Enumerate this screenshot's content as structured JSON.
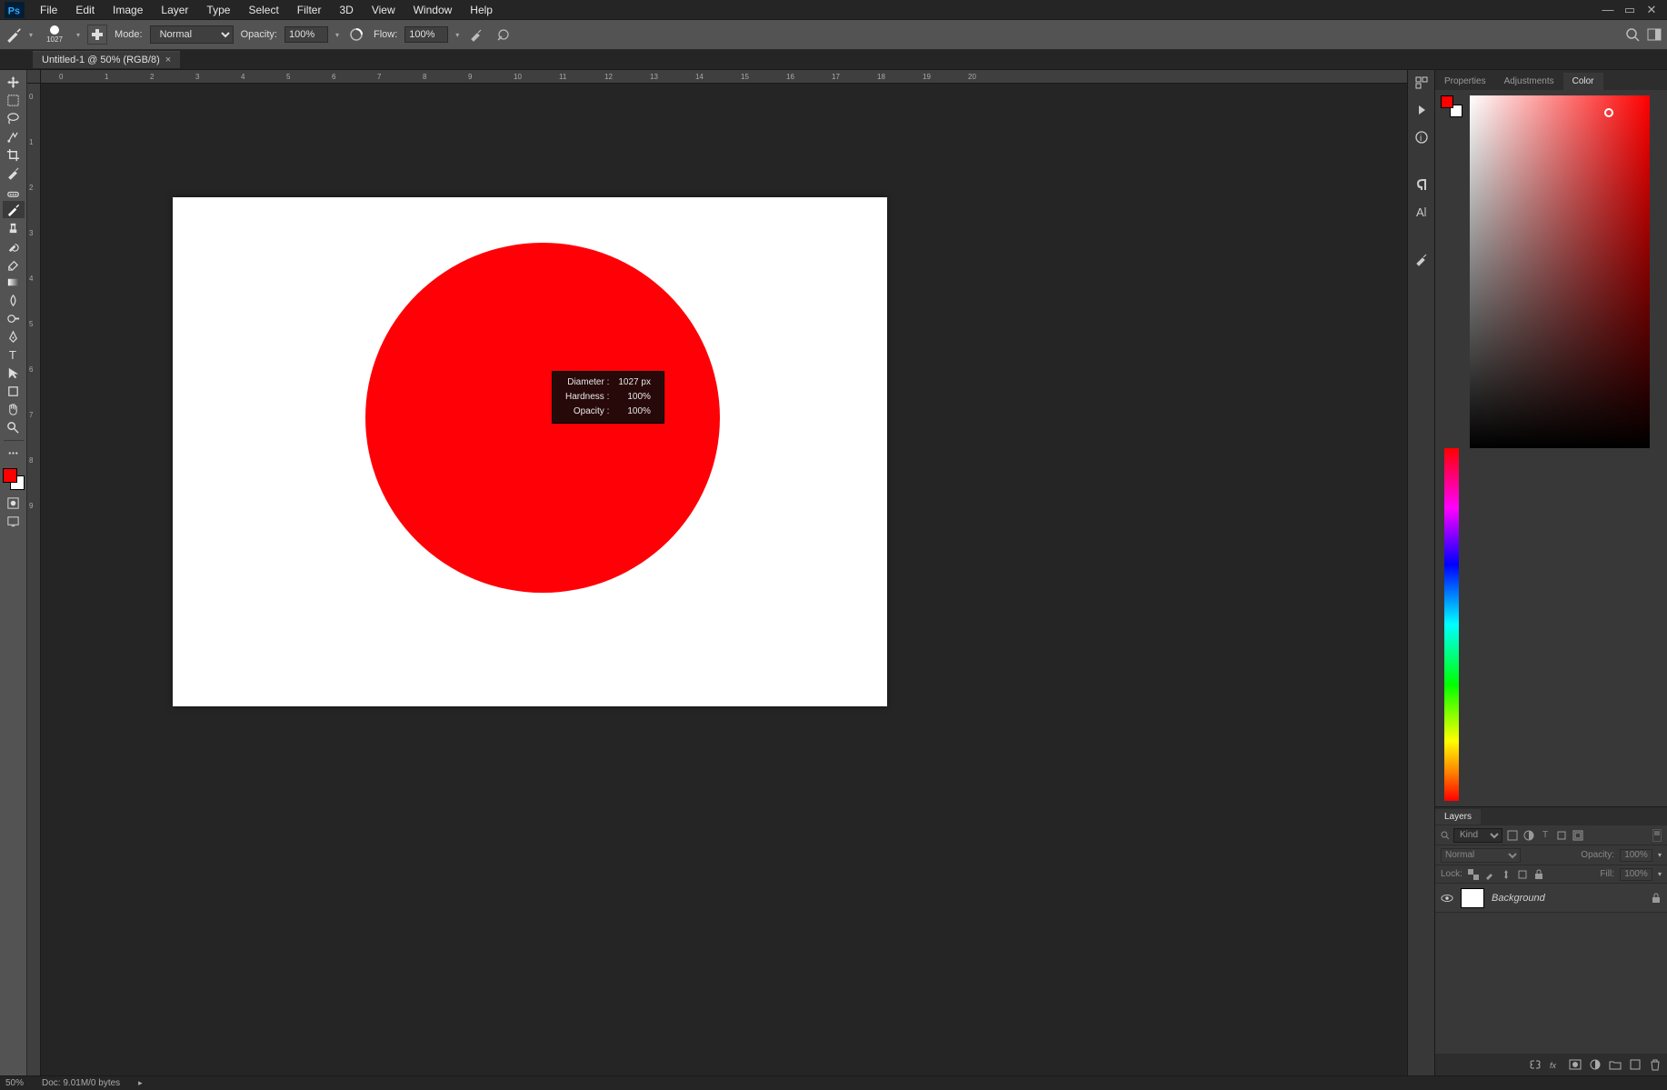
{
  "menubar": [
    "File",
    "Edit",
    "Image",
    "Layer",
    "Type",
    "Select",
    "Filter",
    "3D",
    "View",
    "Window",
    "Help"
  ],
  "options": {
    "brush_size": "1027",
    "mode_label": "Mode:",
    "mode_value": "Normal",
    "opacity_label": "Opacity:",
    "opacity_value": "100%",
    "flow_label": "Flow:",
    "flow_value": "100%"
  },
  "document_tab": "Untitled-1 @ 50% (RGB/8)",
  "ruler_h_values": [
    "0",
    "1",
    "2",
    "3",
    "4",
    "5",
    "6",
    "7",
    "8",
    "9",
    "10",
    "11",
    "12",
    "13",
    "14",
    "15",
    "16",
    "17",
    "18",
    "19",
    "20"
  ],
  "ruler_v_values": [
    "0",
    "1",
    "2",
    "3",
    "4",
    "5",
    "6",
    "7",
    "8",
    "9"
  ],
  "tooltip": {
    "diameter_label": "Diameter :",
    "diameter_value": "1027 px",
    "hardness_label": "Hardness :",
    "hardness_value": "100%",
    "opacity_label": "Opacity :",
    "opacity_value": "100%"
  },
  "right_tabs": {
    "properties": "Properties",
    "adjustments": "Adjustments",
    "color": "Color"
  },
  "layers": {
    "tab": "Layers",
    "kind_search": "Kind",
    "blend_mode": "Normal",
    "opacity_label": "Opacity:",
    "opacity_value": "100%",
    "lock_label": "Lock:",
    "fill_label": "Fill:",
    "fill_value": "100%",
    "layer_name": "Background"
  },
  "status": {
    "zoom": "50%",
    "doc_info": "Doc: 9.01M/0 bytes"
  }
}
